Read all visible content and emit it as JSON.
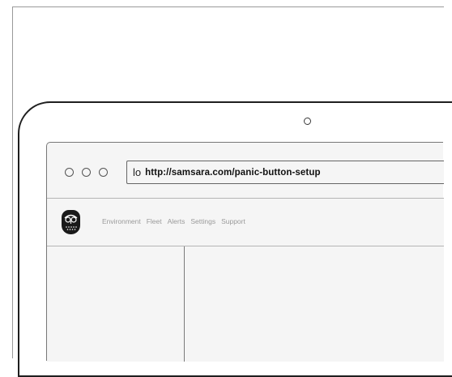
{
  "browser": {
    "url_prefix": "lo",
    "url": "http://samsara.com/panic-button-setup"
  },
  "nav": {
    "logo_icon": "owl-logo-icon",
    "items": [
      "Environment",
      "Fleet",
      "Alerts",
      "Settings",
      "Support"
    ]
  },
  "colors": {
    "device_bezel": "#1f1f1f",
    "browser_bg": "#f5f5f5",
    "nav_text": "#9a9a9a"
  }
}
